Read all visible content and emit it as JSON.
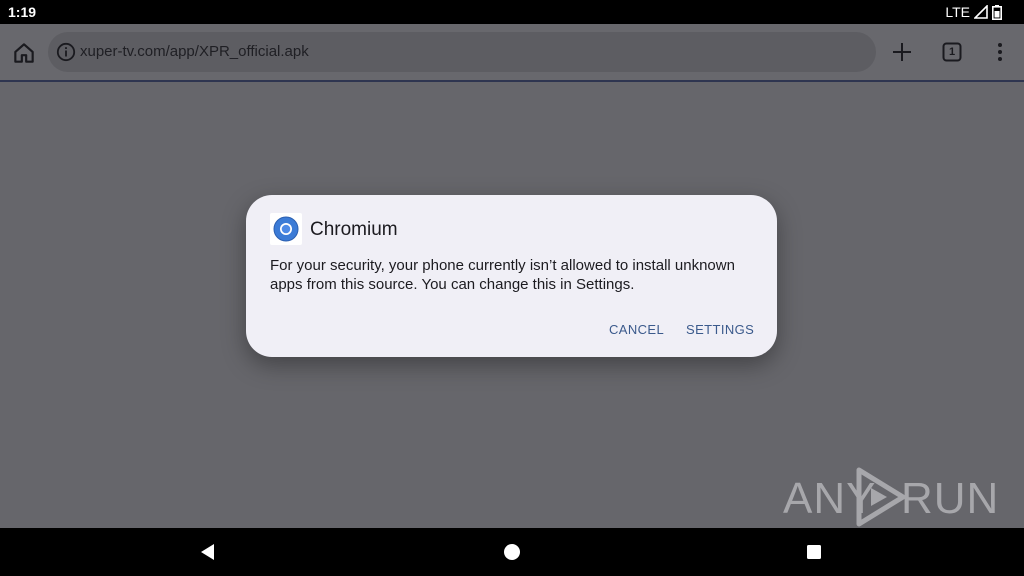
{
  "status_bar": {
    "time": "1:19",
    "network": "LTE",
    "icons": [
      "signal-icon",
      "battery-icon"
    ]
  },
  "toolbar": {
    "url": "xuper-tv.com/app/XPR_official.apk",
    "tab_count": "1",
    "icons": [
      "home-icon",
      "info-icon",
      "plus-icon",
      "tab-switcher-icon",
      "more-vert-icon"
    ]
  },
  "dialog": {
    "app_name": "Chromium",
    "app_icon": "chromium-icon",
    "message": "For your security, your phone currently isn’t allowed to install unknown apps from this source. You can change this in Settings.",
    "cancel_label": "CANCEL",
    "settings_label": "SETTINGS",
    "accent_color": "#3b5a8c"
  },
  "watermark": {
    "left_text": "ANY",
    "right_text": "RUN"
  },
  "nav_bar": {
    "icons": [
      "back-icon",
      "home-circle-icon",
      "recents-icon"
    ]
  },
  "colors": {
    "scrim": "#66666b",
    "dialog_bg": "#f0eff6",
    "status_bar_bg": "#000000"
  }
}
